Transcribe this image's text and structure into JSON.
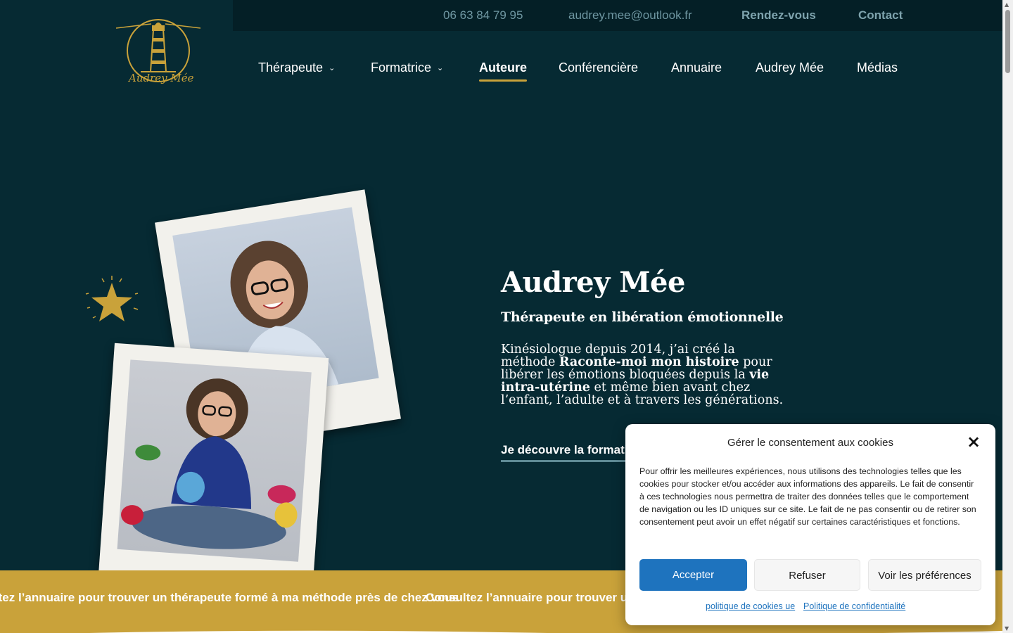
{
  "topbar": {
    "phone": "06 63 84 79 95",
    "email": "audrey.mee@outlook.fr",
    "appointment": "Rendez-vous",
    "contact": "Contact"
  },
  "logo": {
    "text": "Audrey Mée"
  },
  "nav": {
    "items": [
      {
        "label": "Thérapeute"
      },
      {
        "label": "Formatrice"
      },
      {
        "label": "Auteure"
      },
      {
        "label": "Conférencière"
      },
      {
        "label": "Annuaire"
      },
      {
        "label": "Audrey Mée"
      },
      {
        "label": "Médias"
      }
    ],
    "chevron": "⌄"
  },
  "hero": {
    "title": "Audrey Mée",
    "subtitle": "Thérapeute en libération émotionnelle",
    "text_1": "Kinésiologue depuis 2014, j’ai créé la méthode ",
    "text_bold_1": "Raconte-moi mon histoire",
    "text_2": " pour libérer les émotions bloquées depuis la ",
    "text_bold_2": "vie intra-utérine",
    "text_3": " et même bien avant chez l’enfant, l’adulte et à travers les générations.",
    "cta": "Je découvre la formation"
  },
  "band": {
    "message": "Consultez l’annuaire pour trouver un thérapeute formé à ma méthode près de chez vous"
  },
  "cookie": {
    "title": "Gérer le consentement aux cookies",
    "body": "Pour offrir les meilleures expériences, nous utilisons des technologies telles que les cookies pour stocker et/ou accéder aux informations des appareils. Le fait de consentir à ces technologies nous permettra de traiter des données telles que le comportement de navigation ou les ID uniques sur ce site. Le fait de ne pas consentir ou de retirer son consentement peut avoir un effet négatif sur certaines caractéristiques et fonctions.",
    "accept": "Accepter",
    "refuse": "Refuser",
    "preferences": "Voir les préférences",
    "cookie_policy": "politique de cookies ue",
    "privacy_policy": "Politique de confidentialité",
    "close": "×"
  },
  "colors": {
    "background": "#062a33",
    "topbar": "#041f26",
    "gold": "#c9a23a",
    "accent_blue": "#1e73be"
  }
}
